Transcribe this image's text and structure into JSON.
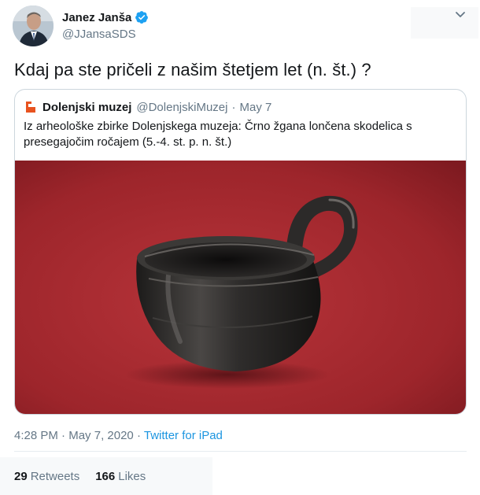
{
  "author": {
    "name": "Janez Janša",
    "handle": "@JJansaSDS",
    "verified_icon": "verified-badge-icon",
    "avatar": "avatar-photo"
  },
  "menu_icon": "chevron-down-icon",
  "tweet": {
    "text": "Kdaj pa ste pričeli z našim štetjem let (n. št.) ?"
  },
  "quoted_tweet": {
    "logo": "museum-logo-icon",
    "name": "Dolenjski muzej",
    "handle": "@DolenjskiMuzej",
    "separator": "·",
    "date": "May 7",
    "text": "Iz arheološke zbirke Dolenjskega muzeja: Črno žgana lončena skodelica s presegajočim ročajem (5.-4. st. p. n. št.)",
    "image": "black-clay-cup-on-red-background"
  },
  "meta": {
    "time": "4:28 PM",
    "separator": "·",
    "date": "May 7, 2020",
    "separator2": "·",
    "source": "Twitter for iPad"
  },
  "stats": {
    "retweets_count": "29",
    "retweets_label": "Retweets",
    "likes_count": "166",
    "likes_label": "Likes"
  },
  "colors": {
    "link": "#1b95e0",
    "secondary_text": "#657786",
    "primary_text": "#14171a",
    "verified": "#1da1f2",
    "image_background": "#a8292f"
  }
}
